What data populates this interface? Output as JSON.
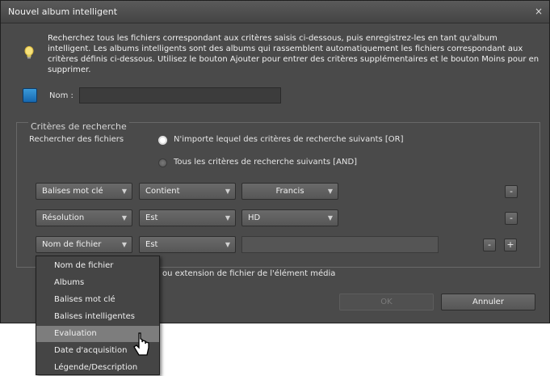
{
  "window": {
    "title": "Nouvel album intelligent",
    "close_glyph": "×"
  },
  "intro": {
    "icon": "lightbulb-icon",
    "text": "Recherchez tous les fichiers correspondant aux critères saisis ci-dessous, puis enregistrez-les en tant qu'album intelligent. Les albums intelligents sont des albums qui rassemblent automatiquement les fichiers correspondant aux critères définis ci-dessous. Utilisez le bouton Ajouter pour entrer des critères supplémentaires et le bouton Moins pour en supprimer."
  },
  "name": {
    "label": "Nom :",
    "value": ""
  },
  "criteria": {
    "legend": "Critères de recherche",
    "search_label": "Rechercher des fichiers",
    "options": [
      {
        "label": "N'importe lequel des critères de recherche suivants [OR]",
        "selected": true
      },
      {
        "label": "Tous les critères de recherche suivants [AND]",
        "selected": false
      }
    ],
    "rows": [
      {
        "field": "Balises mot clé",
        "operator": "Contient",
        "value": "Francis"
      },
      {
        "field": "Résolution",
        "operator": "Est",
        "value": "HD"
      },
      {
        "field": "Nom de fichier",
        "operator": "Est",
        "value": ""
      }
    ],
    "remove_glyph": "-",
    "add_glyph": "+",
    "dropdown_arrow": "▼"
  },
  "footnote": "ou extension de fichier de l'élément média",
  "buttons": {
    "ok": "OK",
    "cancel": "Annuler"
  },
  "menu": {
    "items": [
      "Nom de fichier",
      "Albums",
      "Balises mot clé",
      "Balises intelligentes",
      "Evaluation",
      "Date d'acquisition",
      "Légende/Description"
    ],
    "highlighted_index": 4
  },
  "colors": {
    "dialog_bg": "#4a4a4a",
    "checkbox_blue": "#1f7ac4",
    "menu_highlight": "#7d7d7d"
  }
}
